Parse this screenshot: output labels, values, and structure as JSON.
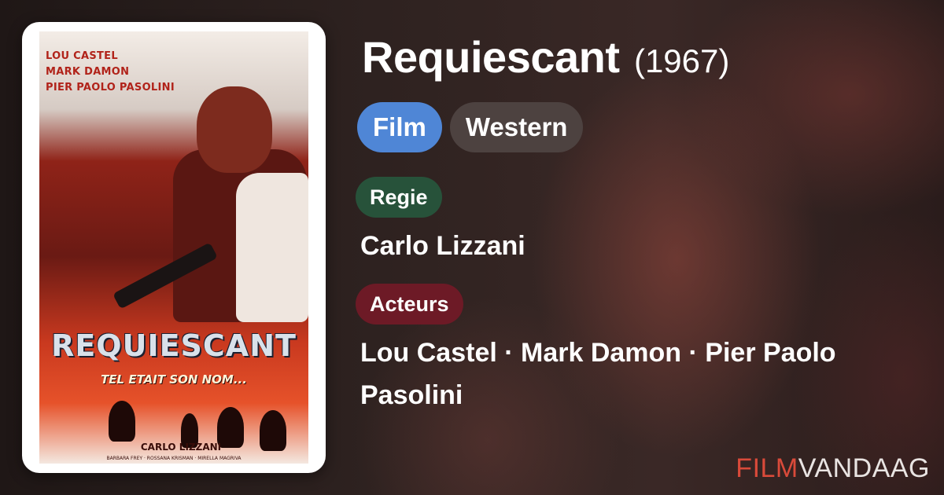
{
  "poster": {
    "cast_lines": [
      "LOU CASTEL",
      "MARK DAMON",
      "PIER PAOLO PASOLINI"
    ],
    "title": "REQUIESCANT",
    "subtitle": "TEL ETAIT SON NOM...",
    "director": "CARLO LIZZANI",
    "credits": "BARBARA FREY · ROSSANA KRISMAN · MIRELLA MAGRIVA"
  },
  "movie": {
    "title": "Requiescant",
    "year": "(1967)"
  },
  "tags": [
    {
      "label": "Film",
      "color": "#4f86d6"
    },
    {
      "label": "Western",
      "color": "#4d4240"
    }
  ],
  "director": {
    "label": "Regie",
    "label_color": "#27523a",
    "value": "Carlo Lizzani"
  },
  "actors": {
    "label": "Acteurs",
    "label_color": "#6d1a26",
    "value": "Lou Castel · Mark Damon · Pier Paolo Pasolini"
  },
  "brand": {
    "part1": "FILM",
    "part2": "VANDAAG",
    "part1_color": "#d94a3a",
    "part2_color": "#e9e4e2"
  }
}
